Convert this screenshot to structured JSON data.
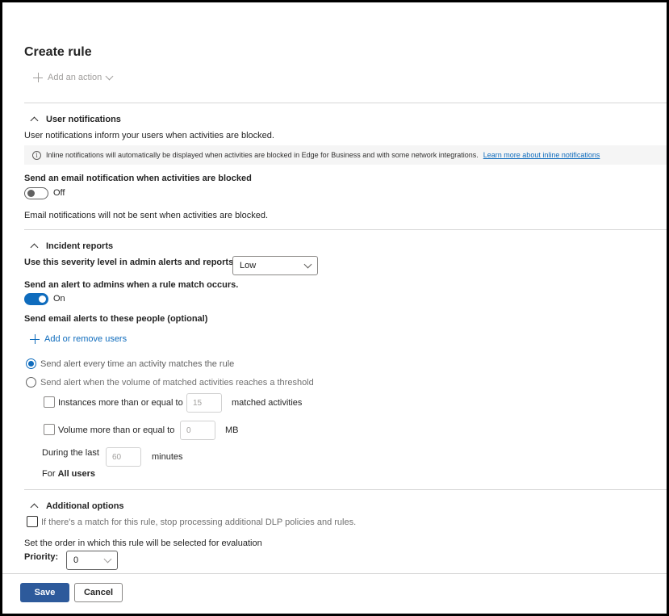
{
  "page": {
    "title": "Create rule"
  },
  "actions": {
    "add_action_label": "Add an action"
  },
  "user_notifications": {
    "heading": "User notifications",
    "description": "User notifications inform your users when activities are blocked.",
    "info_text": "Inline notifications will automatically be displayed when activities are blocked in Edge for Business and with some network integrations.",
    "info_link": "Learn more about inline notifications",
    "email_toggle_label": "Send an email notification when activities are blocked",
    "email_toggle_state": "Off",
    "email_note": "Email notifications will not be sent when activities are blocked."
  },
  "incident_reports": {
    "heading": "Incident reports",
    "severity_label": "Use this severity level in admin alerts and reports:",
    "severity_value": "Low",
    "alert_toggle_label": "Send an alert to admins when a rule match occurs.",
    "alert_toggle_state": "On",
    "email_alerts_label": "Send email alerts to these people (optional)",
    "add_users_label": "Add or remove users",
    "radio_every_time": "Send alert every time an activity matches the rule",
    "radio_threshold": "Send alert when the volume of matched activities reaches a threshold",
    "instances_label": "Instances more than or equal to",
    "instances_value": "15",
    "instances_suffix": "matched activities",
    "volume_label": "Volume more than or equal to",
    "volume_value": "0",
    "volume_suffix": "MB",
    "during_label": "During the last",
    "during_value": "60",
    "during_suffix": "minutes",
    "for_prefix": "For",
    "for_value": "All users"
  },
  "additional_options": {
    "heading": "Additional options",
    "stop_processing_label": "If there's a match for this rule, stop processing additional DLP policies and rules.",
    "order_label": "Set the order in which this rule will be selected for evaluation",
    "priority_label": "Priority:",
    "priority_value": "0"
  },
  "footer": {
    "save_label": "Save",
    "cancel_label": "Cancel"
  },
  "colors": {
    "accent": "#0f6cbd",
    "primary_button": "#2d5a9b"
  }
}
